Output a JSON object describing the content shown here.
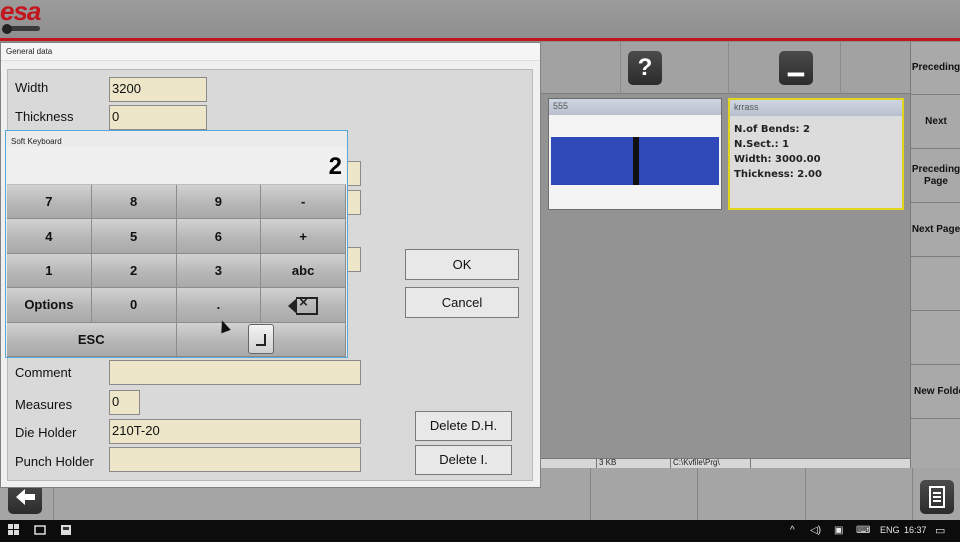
{
  "app": {
    "logo_text": "esa"
  },
  "dialog": {
    "title": "General data",
    "fields": {
      "width_label": "Width",
      "width_value": "3200",
      "thickness_label": "Thickness",
      "thickness_value": "0",
      "comment_label": "Comment",
      "comment_value": "",
      "measures_label": "Measures",
      "measures_value": "0",
      "die_holder_label": "Die Holder",
      "die_holder_value": "210T-20",
      "punch_holder_label": "Punch Holder",
      "punch_holder_value": ""
    },
    "buttons": {
      "ok": "OK",
      "cancel": "Cancel",
      "delete_dh": "Delete D.H.",
      "delete_i": "Delete I."
    }
  },
  "keyboard": {
    "title": "Soft Keyboard",
    "value": "2",
    "keys": [
      "7",
      "8",
      "9",
      "-",
      "4",
      "5",
      "6",
      "+",
      "1",
      "2",
      "3",
      "abc",
      "Options",
      "0",
      ".",
      "ESC"
    ]
  },
  "toolstrip": {
    "help_label": "?",
    "minimize_label": "▁"
  },
  "files": [
    {
      "title": "555"
    },
    {
      "title": "krrass",
      "lines": [
        "N.of Bends: 2",
        "N.Sect.: 1",
        "Width: 3000.00",
        "Thickness: 2.00"
      ]
    }
  ],
  "status": {
    "size": "3 KB",
    "path": "C:\\Kvfile\\Prg\\"
  },
  "side_menu": [
    "Preceding",
    "Next",
    "Preceding Page",
    "Next Page",
    "New Folder"
  ],
  "taskbar": {
    "language": "ENG",
    "time": "16:37"
  },
  "colors": {
    "brand_red": "#c4141c",
    "selection_yellow": "#e3d41e",
    "input_bg": "#ede6c8"
  }
}
